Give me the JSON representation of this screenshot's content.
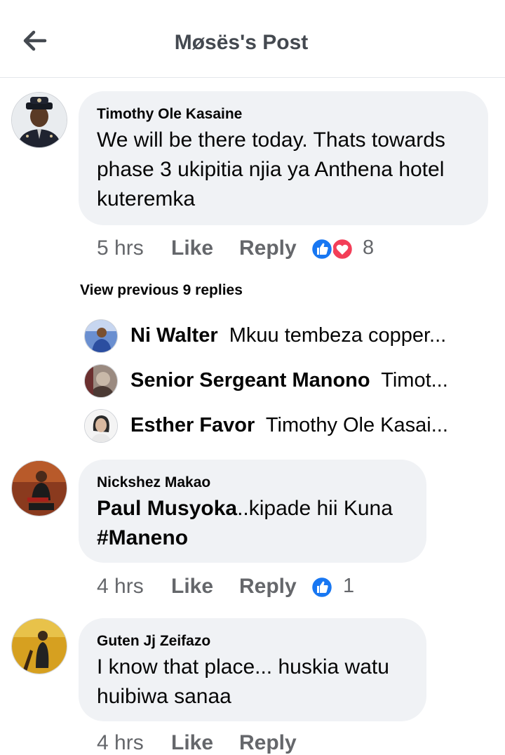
{
  "header": {
    "title": "Møsës's Post",
    "back_icon": "arrow-left-icon"
  },
  "comments": [
    {
      "author": "Timothy Ole Kasaine",
      "text": "We will be there today. Thats towards\nphase 3 ukipitia njia ya Anthena hotel\nkuteremka",
      "time": "5 hrs",
      "like_label": "Like",
      "reply_label": "Reply",
      "reaction_icons": [
        "like-icon",
        "love-icon"
      ],
      "reaction_count": "8"
    },
    {
      "author": "Nickshez Makao",
      "mention": "Paul Musyoka",
      "text_after_mention": "..kipade hii Kuna",
      "hashtag": "#Maneno",
      "time": "4 hrs",
      "like_label": "Like",
      "reply_label": "Reply",
      "reaction_icons": [
        "like-icon"
      ],
      "reaction_count": "1"
    },
    {
      "author": "Guten Jj Zeifazo",
      "text": "I know that place... huskia watu\nhuibiwa sanaa",
      "time": "4 hrs",
      "like_label": "Like",
      "reply_label": "Reply"
    }
  ],
  "replies_section": {
    "view_previous": "View previous 9 replies",
    "replies": [
      {
        "author": "Ni Walter",
        "preview": "Mkuu tembeza copper..."
      },
      {
        "author": "Senior Sergeant Manono",
        "preview": "Timot..."
      },
      {
        "author": "Esther Favor",
        "preview": "Timothy Ole Kasai..."
      }
    ]
  },
  "colors": {
    "accent": "#1877f2",
    "love": "#f33e58",
    "bubble": "#f0f2f5",
    "muted": "#65676b"
  }
}
